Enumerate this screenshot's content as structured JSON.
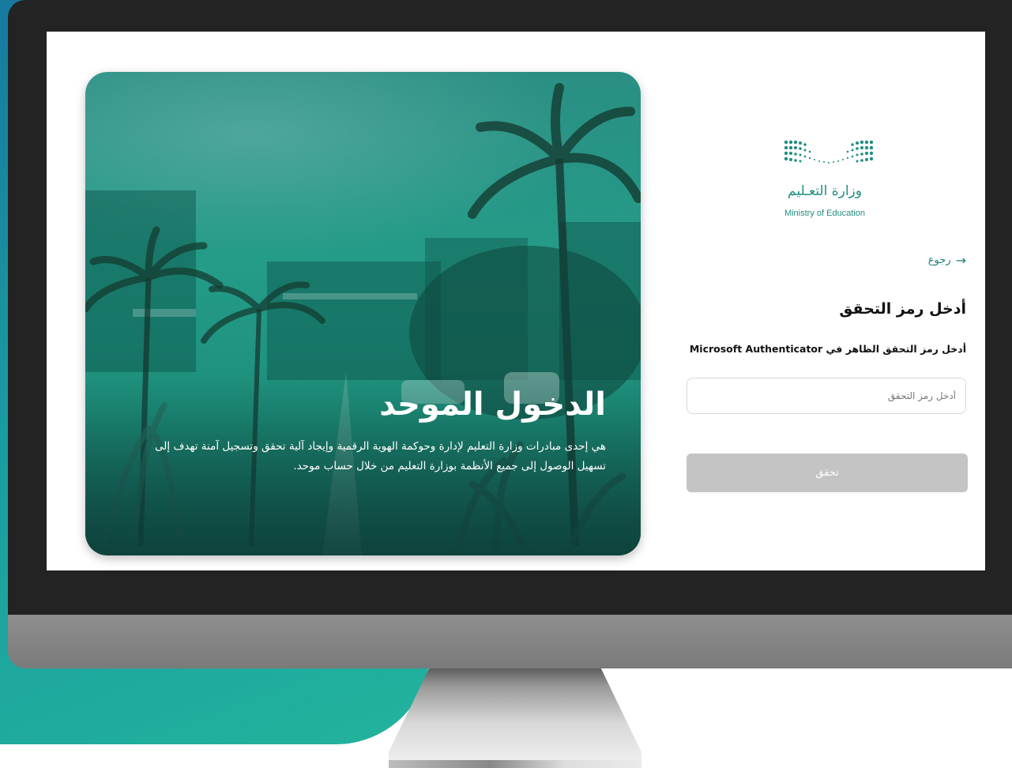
{
  "colors": {
    "brand_teal": "#1f8f7f",
    "button_disabled": "#c4c4c4",
    "monitor_frame": "#232323",
    "background_teal": "#1a9aa0"
  },
  "logo": {
    "arabic_text": "وزارة التعـليم",
    "english_text": "Ministry of Education"
  },
  "hero": {
    "title": "الدخول الموحد",
    "description": "هي إحدى مبادرات وزارة التعليم لإدارة وحوكمة الهوية الرقمية وإيجاد آلية تحقق وتسجيل آمنة تهدف إلى تسهيل الوصول إلى جميع الأنظمة بوزارة التعليم من خلال حساب موحد."
  },
  "form": {
    "back_label": "رجوع",
    "back_icon": "arrow-right-icon",
    "title": "أدخل رمز التحقق",
    "subtitle": "أدخل رمز التحقق الظاهر في Microsoft Authenticator",
    "code_placeholder": "أدخل رمز التحقق",
    "code_value": "",
    "verify_label": "تحقق"
  }
}
